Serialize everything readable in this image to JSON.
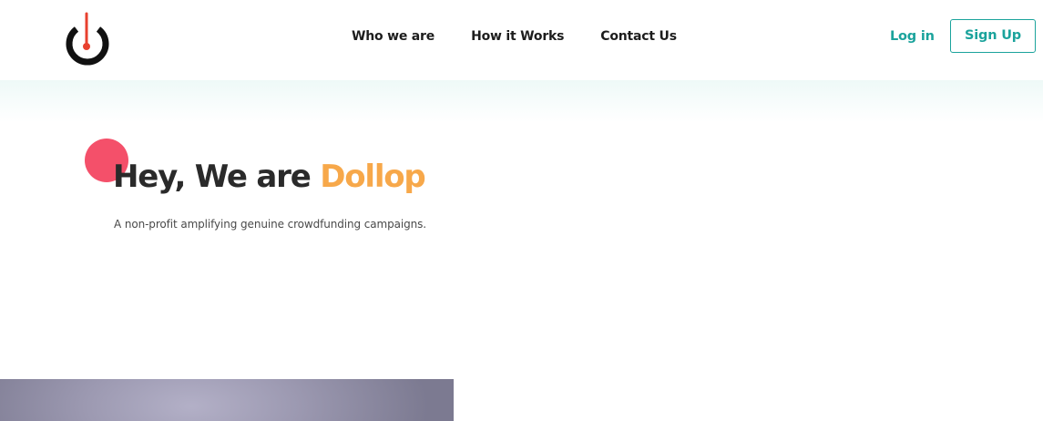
{
  "header": {
    "logo_name": "power-logo-icon",
    "nav": [
      {
        "label": "Who we are"
      },
      {
        "label": "How it Works"
      },
      {
        "label": "Contact Us"
      }
    ],
    "login_label": "Log in",
    "signup_label": "Sign Up"
  },
  "hero": {
    "title_prefix": "Hey, We are ",
    "title_brand": "Dollop",
    "subtitle": "A non-profit amplifying genuine crowdfunding campaigns."
  },
  "colors": {
    "accent_teal": "#1ba39c",
    "brand_orange": "#f7a84a",
    "dot_red": "#f4506a",
    "logo_red": "#e8412f",
    "text_dark": "#2a2a2a"
  }
}
